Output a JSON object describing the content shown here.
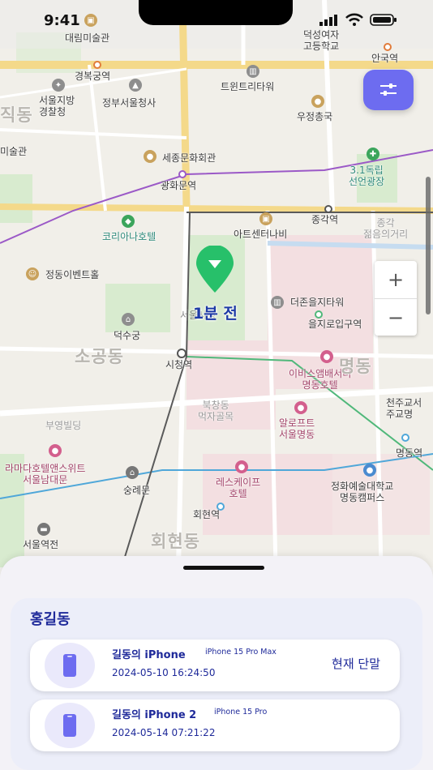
{
  "status_bar": {
    "time": "9:41"
  },
  "map": {
    "labels": {
      "daerim": "대림미술관",
      "deoksung": "덕성여자\n고등학교",
      "anguk": "안국역",
      "gyeongbok": "경복궁역",
      "twin": "트윈트리타워",
      "seoul_police": "서울지방\n경찰청",
      "gov_complex": "정부서울청사",
      "ujeong": "우정총국",
      "jikdong": "직동",
      "museum": "미술관",
      "sejong": "세종문화회관",
      "samil": "3.1독립\n선언광장",
      "gwanghwamun": "광화문역",
      "jonggak": "종각역",
      "jonggak_youth": "종각\n젊음의거리",
      "koreana": "코리아나호텔",
      "artcenter": "아트센터나비",
      "jeongdong": "정동이벤트홀",
      "the_center": "더존을지타워",
      "euljiro": "을지로입구역",
      "deoksu": "덕수궁",
      "sogong": "소공동",
      "cityhall": "시청역",
      "ibis": "이비스앰배서더\n명동호텔",
      "myeongdong_area": "명동",
      "cheonju": "천주교서\n주교명",
      "bukchang": "북창동\n먹자골목",
      "loft": "알로프트\n서울명동",
      "buyoung": "부영빌딩",
      "ramada": "라마다호텔앤스위트\n서울남대문",
      "myeongdong_stn": "명동역",
      "sungnyemun": "숭례문",
      "lescape": "레스케이프\n호텔",
      "arts_univ": "정화예술대학교\n명동캠퍼스",
      "hoehyeon_stn": "회현역",
      "seoul_station": "서울역전",
      "hoehyeon_dong": "회현동",
      "seoul_cityhall_bldg": "서울시청"
    },
    "marker_label": "1분 전",
    "zoom": {
      "in": "+",
      "out": "−"
    }
  },
  "icons": {
    "filter": "sliders-icon",
    "marker": "location-pin-icon",
    "device": "phone-icon"
  },
  "sheet": {
    "owner_name": "홍길동",
    "devices": [
      {
        "name": "길동의 iPhone",
        "model": "iPhone 15 Pro Max",
        "timestamp": "2024-05-10 16:24:50",
        "tag": "현재 단말"
      },
      {
        "name": "길동의 iPhone 2",
        "model": "iPhone 15 Pro",
        "timestamp": "2024-05-14 07:21:22",
        "tag": ""
      }
    ]
  },
  "colors": {
    "accent": "#6d6cf0",
    "marker": "#27c06a",
    "text_primary": "#1f2a9a"
  }
}
